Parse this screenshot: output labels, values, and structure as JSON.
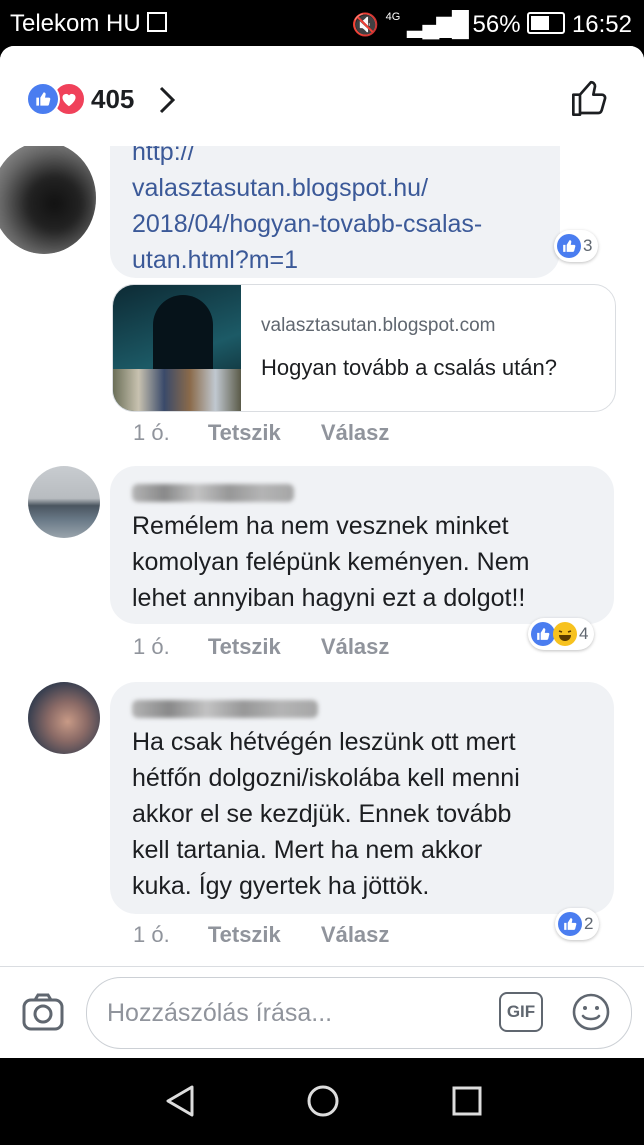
{
  "status_bar": {
    "carrier": "Telekom HU",
    "network": "4G",
    "battery": "56%",
    "time": "16:52"
  },
  "reactions_header": {
    "count": "405",
    "icons": [
      "like-icon",
      "love-icon"
    ]
  },
  "comments": [
    {
      "link_lines": [
        "http://",
        "valasztasutan.blogspot.hu/",
        "2018/04/hogyan-tovabb-csalas-",
        "utan.html?m=1"
      ],
      "reaction_count": "3",
      "preview": {
        "domain": "valasztasutan.blogspot.com",
        "title": "Hogyan tovább a csalás után?"
      },
      "time": "1 ó.",
      "like_label": "Tetszik",
      "reply_label": "Válasz"
    },
    {
      "text_lines": [
        "Remélem ha nem vesznek minket",
        "komolyan felépünk keményen. Nem",
        "lehet annyiban hagyni ezt a dolgot!!"
      ],
      "reaction_count": "4",
      "time": "1 ó.",
      "like_label": "Tetszik",
      "reply_label": "Válasz"
    },
    {
      "text_lines": [
        "Ha csak hétvégén leszünk ott mert",
        "hétfőn dolgozni/iskolába kell menni",
        "akkor el se kezdjük. Ennek tovább",
        "kell tartania. Mert ha nem akkor",
        "kuka. Így gyertek ha jöttök."
      ],
      "reaction_count": "2",
      "time": "1 ó.",
      "like_label": "Tetszik",
      "reply_label": "Válasz"
    }
  ],
  "composer": {
    "placeholder": "Hozzászólás írása...",
    "gif_label": "GIF"
  },
  "colors": {
    "like_blue": "#4a7df0",
    "love_red": "#f0415a",
    "link": "#3b5998",
    "bubble": "#f0f2f5",
    "meta": "#90949c"
  }
}
